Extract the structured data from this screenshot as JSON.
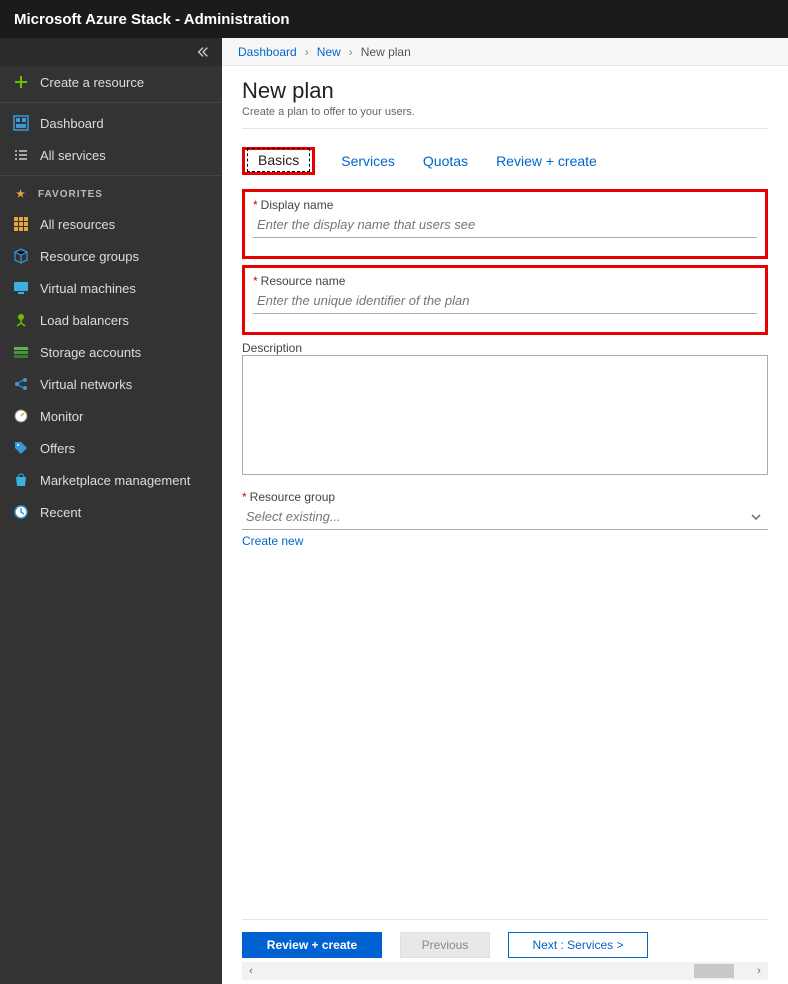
{
  "header": {
    "title": "Microsoft Azure Stack - Administration"
  },
  "sidebar": {
    "create": "Create a resource",
    "dashboard": "Dashboard",
    "all_services": "All services",
    "favorites_label": "FAVORITES",
    "items": [
      {
        "label": "All resources"
      },
      {
        "label": "Resource groups"
      },
      {
        "label": "Virtual machines"
      },
      {
        "label": "Load balancers"
      },
      {
        "label": "Storage accounts"
      },
      {
        "label": "Virtual networks"
      },
      {
        "label": "Monitor"
      },
      {
        "label": "Offers"
      },
      {
        "label": "Marketplace management"
      },
      {
        "label": "Recent"
      }
    ]
  },
  "breadcrumb": {
    "a": "Dashboard",
    "b": "New",
    "c": "New plan"
  },
  "page": {
    "title": "New plan",
    "subtitle": "Create a plan to offer to your users."
  },
  "tabs": {
    "basics": "Basics",
    "services": "Services",
    "quotas": "Quotas",
    "review": "Review + create"
  },
  "form": {
    "display_name_label": "Display name",
    "display_name_ph": "Enter the display name that users see",
    "resource_name_label": "Resource name",
    "resource_name_ph": "Enter the unique identifier of the plan",
    "description_label": "Description",
    "rg_label": "Resource group",
    "rg_ph": "Select existing...",
    "create_new": "Create new"
  },
  "footer": {
    "review": "Review + create",
    "previous": "Previous",
    "next": "Next : Services >"
  }
}
